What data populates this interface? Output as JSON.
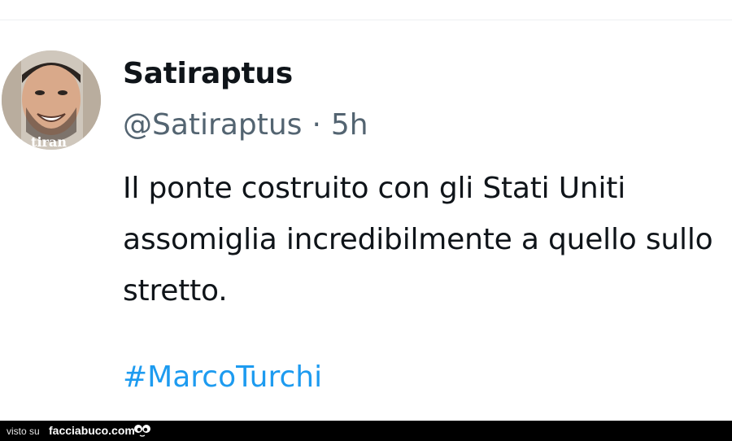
{
  "tweet": {
    "display_name": "Satiraptus",
    "handle": "@Satiraptus",
    "separator": "·",
    "time": "5h",
    "text": "Il ponte costruito con gli Stati Uniti assomiglia incredibilmente a quello sullo stretto.",
    "hashtag": "#MarcoTurchi",
    "avatar_caption": "tiran",
    "hashtag_color": "#1d9bf0"
  },
  "footer": {
    "visto_label": "visto su",
    "brand": "facciabuco.com",
    "logo_icon": "eyes-icon"
  }
}
